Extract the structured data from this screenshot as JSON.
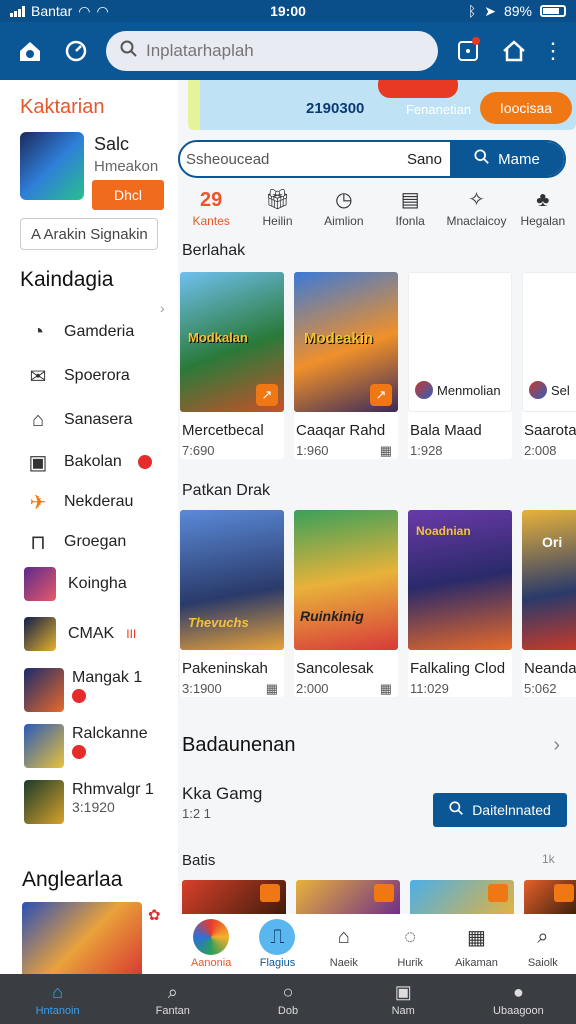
{
  "status_bar": {
    "carrier": "Bantar",
    "time": "19:00",
    "battery": "89%"
  },
  "topbar": {
    "search_placeholder": "Inplatarhaplah"
  },
  "sidebar": {
    "title": "Kaktarian",
    "profile": {
      "name": "Salc",
      "subtitle": "Hmeakon",
      "button": "Dhcl"
    },
    "input_label": "A  Arakin Signakin",
    "section": "Kaindagia",
    "items": [
      {
        "label": "Gamderia",
        "icon": "timer-icon"
      },
      {
        "label": "Spoerora",
        "icon": "mail-icon"
      },
      {
        "label": "Sanasera",
        "icon": "tag-icon"
      },
      {
        "label": "Bakolan",
        "icon": "calendar-icon"
      },
      {
        "label": "Nekderau",
        "icon": "plane-icon"
      },
      {
        "label": "Groegan",
        "icon": "briefcase-icon"
      },
      {
        "label": "Koingha",
        "icon": "game-thumb"
      },
      {
        "label": "CMAK",
        "icon": "game-thumb",
        "tag": "III"
      }
    ],
    "games": [
      {
        "title": "Mangak",
        "extra": "1"
      },
      {
        "title": "Ralckanne",
        "extra": ""
      },
      {
        "title": "Rhmvalgr",
        "extra": "1",
        "sub": "3:1920"
      }
    ],
    "bottom_title": "Anglearlaa"
  },
  "main": {
    "banner": {
      "number": "2190300",
      "label": "Fenanetian",
      "button": "Ioocisaa"
    },
    "search": {
      "placeholder": "Ssheoucead",
      "value": "Sano",
      "button": "Mame"
    },
    "categories": [
      {
        "label": "Kantes",
        "icon": "29"
      },
      {
        "label": "Heilin",
        "icon": "gift-icon"
      },
      {
        "label": "Aimlion",
        "icon": "clock-icon"
      },
      {
        "label": "Ifonla",
        "icon": "document-icon"
      },
      {
        "label": "Mnaclaicoy",
        "icon": "puzzle-icon"
      },
      {
        "label": "Hegalan",
        "icon": "leaf-icon"
      }
    ],
    "section1": "Berlahak",
    "row1": [
      {
        "title": "Mercetbecal",
        "meta": "7:690",
        "img_label": "",
        "tag": "Modkalan"
      },
      {
        "title": "Caaqar Rahd",
        "meta": "1:960",
        "img_label": "",
        "tag": "Modeakin"
      },
      {
        "title": "Bala Maad",
        "meta": "1:928",
        "img_label": "Menmolian"
      },
      {
        "title": "Saarotaa",
        "meta": "2:008",
        "img_label": "Sel"
      }
    ],
    "section2": "Patkan Drak",
    "row2": [
      {
        "title": "Pakeninskah",
        "meta": "3:1900",
        "tag": "Thevuchs"
      },
      {
        "title": "Sancolesak",
        "meta": "2:000",
        "tag": "Ruinkinig"
      },
      {
        "title": "Falkaling Clod",
        "meta": "11:029",
        "tag": "Noadnian"
      },
      {
        "title": "Neandagm",
        "meta": "5:062",
        "tag": "Ori"
      }
    ],
    "big_section": "Badaunenan",
    "kka_title": "Kka Gamg",
    "kka_sub": "1:2 1",
    "blue_button": "Daitelnnated",
    "batis": "Batis",
    "batis_right": "1k",
    "tabs": [
      {
        "label": "Aanonia"
      },
      {
        "label": "Flagius"
      },
      {
        "label": "Naeik"
      },
      {
        "label": "Hurik"
      },
      {
        "label": "Aikaman"
      },
      {
        "label": "Saiolk"
      }
    ]
  },
  "bottom_nav": [
    {
      "label": "Hntanoin",
      "icon": "home-icon",
      "active": true
    },
    {
      "label": "Fantan",
      "icon": "search-icon"
    },
    {
      "label": "Dob",
      "icon": "circle-icon"
    },
    {
      "label": "Nam",
      "icon": "gamepad-icon"
    },
    {
      "label": "Ubaagoon",
      "icon": "user-icon"
    }
  ]
}
